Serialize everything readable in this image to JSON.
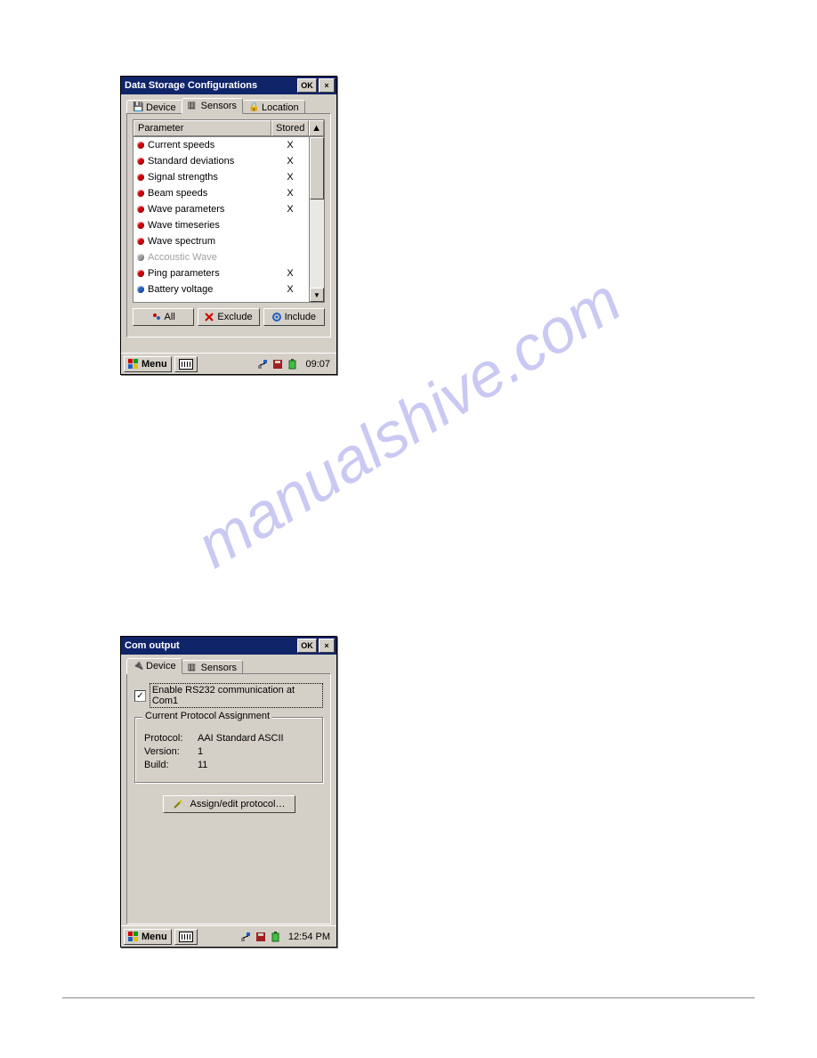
{
  "watermark": "manualshive.com",
  "win1": {
    "title": "Data Storage Configurations",
    "ok": "OK",
    "close": "×",
    "tabs": {
      "device": "Device",
      "sensors": "Sensors",
      "location": "Location"
    },
    "columns": {
      "parameter": "Parameter",
      "stored": "Stored"
    },
    "rows": [
      {
        "name": "Current speeds",
        "stored": "X",
        "color": "red"
      },
      {
        "name": "Standard deviations",
        "stored": "X",
        "color": "red"
      },
      {
        "name": "Signal strengths",
        "stored": "X",
        "color": "red"
      },
      {
        "name": "Beam speeds",
        "stored": "X",
        "color": "red"
      },
      {
        "name": "Wave parameters",
        "stored": "X",
        "color": "red"
      },
      {
        "name": "Wave timeseries",
        "stored": "",
        "color": "red"
      },
      {
        "name": "Wave spectrum",
        "stored": "",
        "color": "red"
      },
      {
        "name": "Accoustic Wave",
        "stored": "",
        "color": "gray",
        "disabled": true
      },
      {
        "name": "Ping parameters",
        "stored": "X",
        "color": "red"
      },
      {
        "name": "Battery voltage",
        "stored": "X",
        "color": "blue"
      }
    ],
    "buttons": {
      "all": "All",
      "exclude": "Exclude",
      "include": "Include"
    },
    "taskbar": {
      "menu": "Menu",
      "clock": "09:07"
    }
  },
  "win2": {
    "title": "Com output",
    "ok": "OK",
    "close": "×",
    "tabs": {
      "device": "Device",
      "sensors": "Sensors"
    },
    "checkbox_label": "Enable RS232 communication at Com1",
    "group": {
      "title": "Current Protocol Assignment",
      "protocol_k": "Protocol:",
      "protocol_v": "AAI Standard ASCII",
      "version_k": "Version:",
      "version_v": "1",
      "build_k": "Build:",
      "build_v": "11"
    },
    "assign": "Assign/edit protocol…",
    "taskbar": {
      "menu": "Menu",
      "clock": "12:54 PM"
    }
  }
}
